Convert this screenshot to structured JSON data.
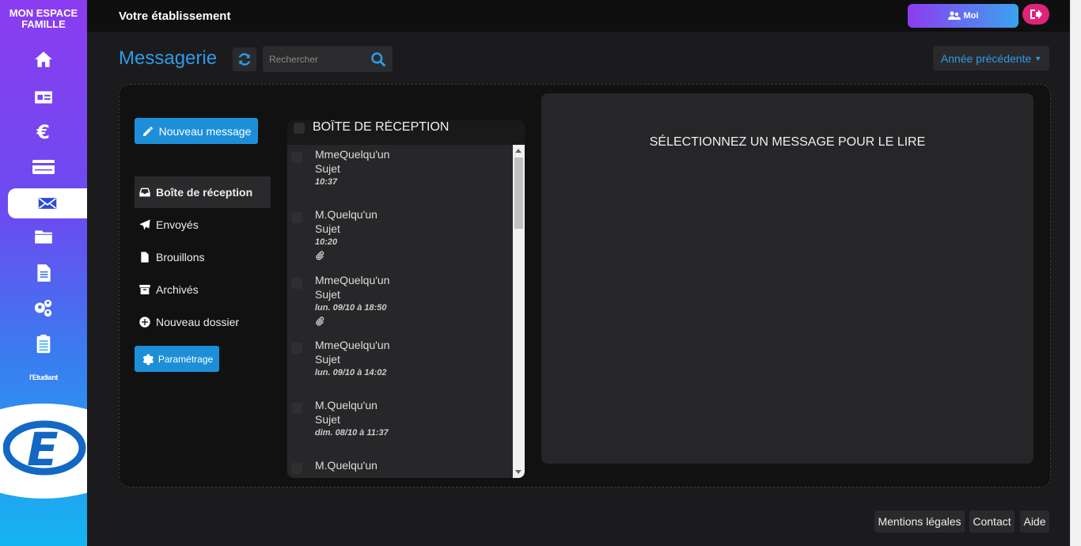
{
  "sidebar": {
    "brand_line1": "MON ESPACE",
    "brand_line2": "FAMILLE",
    "items": [
      {
        "name": "home-icon"
      },
      {
        "name": "id-card-icon"
      },
      {
        "name": "euro-icon"
      },
      {
        "name": "card-icon"
      },
      {
        "name": "envelope-icon",
        "active": true
      },
      {
        "name": "folder-icon"
      },
      {
        "name": "document-icon"
      },
      {
        "name": "users-icon"
      },
      {
        "name": "clipboard-icon"
      }
    ],
    "etudiant_label": "l'Etudiant",
    "logo_letter": "E"
  },
  "topbar": {
    "etablissement": "Votre établissement",
    "moi_label": "Moi"
  },
  "header": {
    "title": "Messagerie",
    "search_placeholder": "Rechercher",
    "annee_label": "Année précédente"
  },
  "actions": {
    "new_message": "Nouveau message",
    "parametrage": "Paramétrage"
  },
  "folders": [
    {
      "label": "Boîte de réception",
      "icon": "inbox-icon",
      "active": true
    },
    {
      "label": "Envoyés",
      "icon": "paper-plane-icon"
    },
    {
      "label": "Brouillons",
      "icon": "file-icon"
    },
    {
      "label": "Archivés",
      "icon": "archive-icon"
    },
    {
      "label": "Nouveau dossier",
      "icon": "plus-circle-icon"
    }
  ],
  "inbox": {
    "title": "BOÎTE DE RÉCEPTION",
    "messages": [
      {
        "from": "MmeQuelqu'un",
        "subject": "Sujet",
        "time": "10:37",
        "attachment": false
      },
      {
        "from": "M.Quelqu'un",
        "subject": "Sujet",
        "time": "10:20",
        "attachment": true
      },
      {
        "from": "MmeQuelqu'un",
        "subject": "Sujet",
        "time": "lun. 09/10 à 18:50",
        "attachment": true
      },
      {
        "from": "MmeQuelqu'un",
        "subject": "Sujet",
        "time": "lun. 09/10 à 14:02",
        "attachment": false
      },
      {
        "from": "M.Quelqu'un",
        "subject": "Sujet",
        "time": "dim. 08/10 à 11:37",
        "attachment": false
      },
      {
        "from": "M.Quelqu'un",
        "subject": "",
        "time": "",
        "attachment": false
      }
    ]
  },
  "reader": {
    "hint": "SÉLECTIONNEZ UN MESSAGE POUR LE LIRE"
  },
  "footer": {
    "mentions": "Mentions légales",
    "contact": "Contact",
    "aide": "Aide"
  },
  "colors": {
    "accent": "#2d9be6",
    "button": "#1d8fd8",
    "logout": "#e0237a"
  }
}
